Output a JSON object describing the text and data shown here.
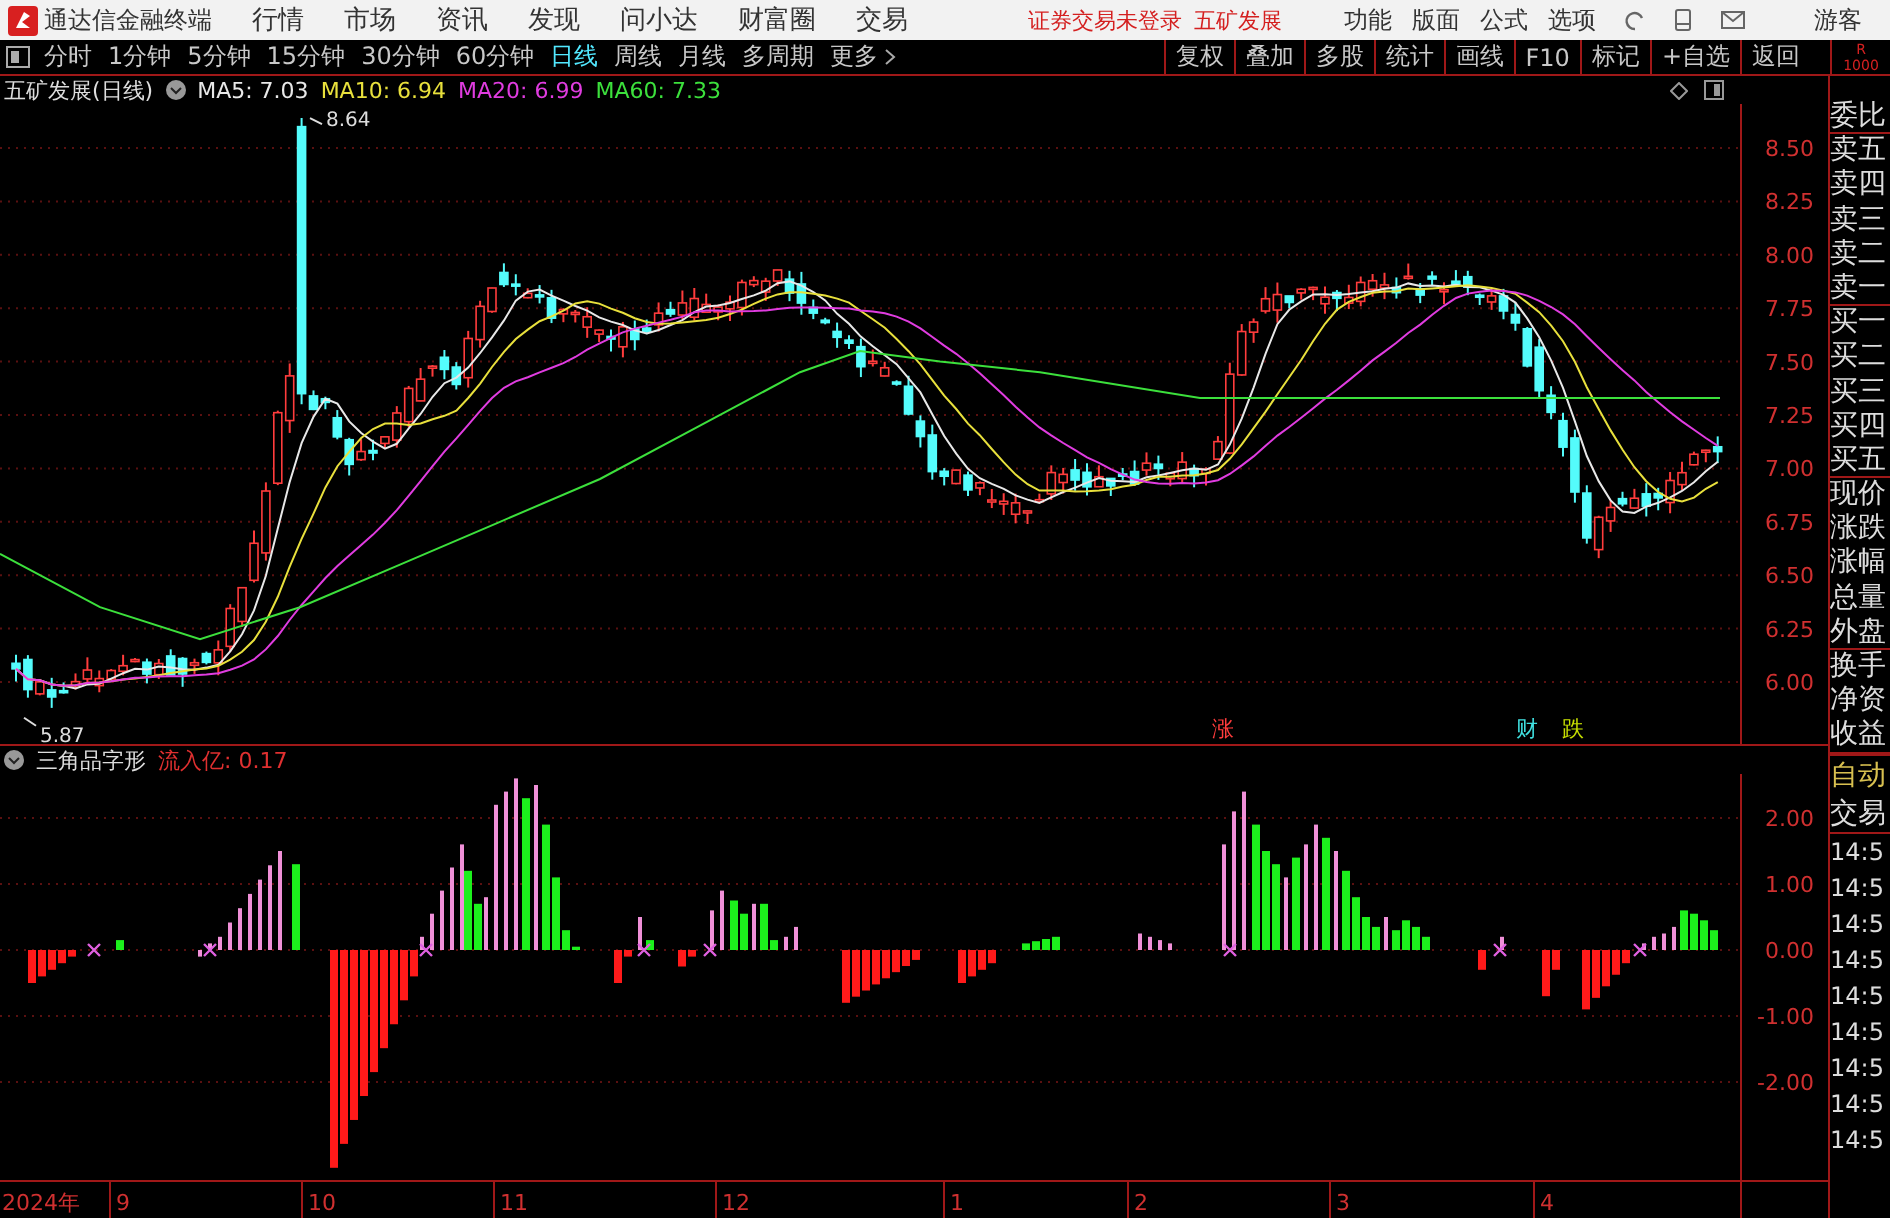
{
  "app": {
    "title": "通达信金融终端"
  },
  "menu": [
    "行情",
    "市场",
    "资讯",
    "发现",
    "问小达",
    "财富圈",
    "交易"
  ],
  "notice": [
    "证券交易未登录",
    "五矿发展"
  ],
  "top_menu": [
    "功能",
    "版面",
    "公式",
    "选项"
  ],
  "user": "游客",
  "periods": [
    {
      "label": "分时",
      "selected": false
    },
    {
      "label": "1分钟",
      "selected": false
    },
    {
      "label": "5分钟",
      "selected": false
    },
    {
      "label": "15分钟",
      "selected": false
    },
    {
      "label": "30分钟",
      "selected": false
    },
    {
      "label": "60分钟",
      "selected": false
    },
    {
      "label": "日线",
      "selected": true
    },
    {
      "label": "周线",
      "selected": false
    },
    {
      "label": "月线",
      "selected": false
    },
    {
      "label": "多周期",
      "selected": false
    }
  ],
  "more": "更多",
  "tools": [
    "复权",
    "叠加",
    "多股",
    "统计",
    "画线",
    "F10",
    "标记",
    "+自选",
    "返回"
  ],
  "corner": [
    "R",
    "1000"
  ],
  "price_chart": {
    "title": "五矿发展(日线)",
    "ma": [
      {
        "label": "MA5: 7.03",
        "color": "#e8e8e8"
      },
      {
        "label": "MA10: 6.94",
        "color": "#e8e03c"
      },
      {
        "label": "MA20: 6.99",
        "color": "#e03ce0"
      },
      {
        "label": "MA60: 7.33",
        "color": "#3ce03c"
      }
    ],
    "y_labels": [
      "8.50",
      "8.25",
      "8.00",
      "7.75",
      "7.50",
      "7.25",
      "7.00",
      "6.75",
      "6.50",
      "6.25",
      "6.00"
    ],
    "extremes": [
      {
        "kind": "high",
        "text": "8.64"
      },
      {
        "kind": "low",
        "text": "5.87"
      }
    ],
    "markers": [
      {
        "text": "涨",
        "color": "#ff3c3c"
      },
      {
        "text": "财",
        "color": "#40e0e0"
      },
      {
        "text": "跌",
        "color": "#c8e000"
      }
    ]
  },
  "indicator": {
    "title": "三角品字形",
    "reading": "流入亿: 0.17",
    "y_labels": [
      "2.00",
      "1.00",
      "0.00",
      "-1.00",
      "-2.00"
    ]
  },
  "x_labels": [
    "2024年",
    "9",
    "10",
    "11",
    "12",
    "1",
    "2",
    "3",
    "4"
  ],
  "side_panel": {
    "quote_labels": [
      "委比",
      "卖五",
      "卖四",
      "卖三",
      "卖二",
      "卖一",
      "买一",
      "买二",
      "买三",
      "买四",
      "买五",
      "现价",
      "涨跌",
      "涨幅",
      "总量",
      "外盘",
      "换手",
      "净资",
      "收益"
    ],
    "mode": [
      "自动",
      "交易"
    ],
    "times": [
      "14:5",
      "14:5",
      "14:5",
      "14:5",
      "14:5",
      "14:5",
      "14:5",
      "14:5",
      "14:5"
    ]
  }
}
